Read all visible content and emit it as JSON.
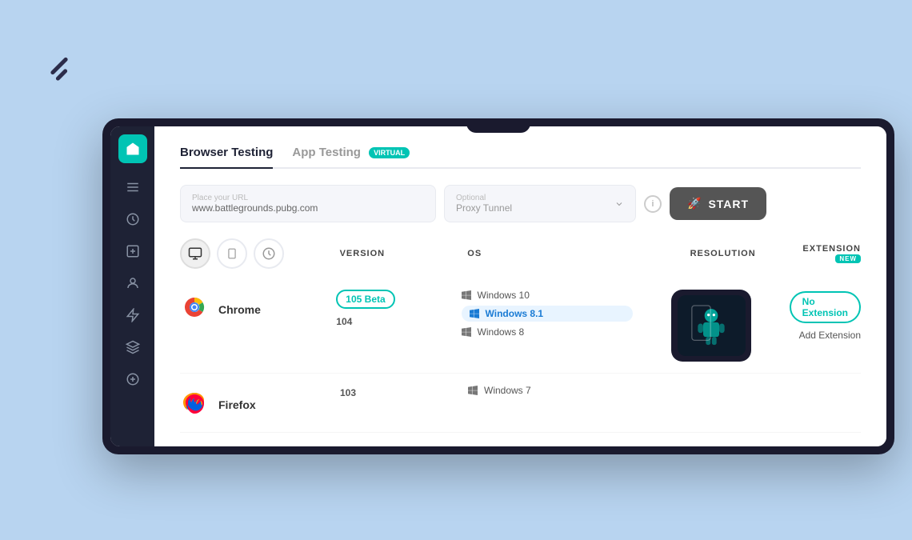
{
  "background": {
    "color": "#b8d4f0"
  },
  "deco_lines": {
    "visible": true
  },
  "device": {
    "frame_color": "#1a1a2e"
  },
  "sidebar": {
    "logo_tooltip": "Home",
    "icons": [
      {
        "name": "arrow-back-icon",
        "symbol": "↺",
        "active": false
      },
      {
        "name": "clock-icon",
        "symbol": "◷",
        "active": false
      },
      {
        "name": "plus-square-icon",
        "symbol": "⊞",
        "active": false
      },
      {
        "name": "user-icon",
        "symbol": "👤",
        "active": false
      },
      {
        "name": "bolt-icon",
        "symbol": "⚡",
        "active": false
      },
      {
        "name": "layers-icon",
        "symbol": "⊕",
        "active": false
      },
      {
        "name": "add-icon",
        "symbol": "+",
        "active": false
      }
    ]
  },
  "tabs": {
    "items": [
      {
        "id": "browser-testing",
        "label": "Browser Testing",
        "active": true,
        "badge": null
      },
      {
        "id": "app-testing",
        "label": "App Testing",
        "active": false,
        "badge": "VIRTUAL"
      }
    ]
  },
  "url_bar": {
    "url_label": "Place your URL",
    "url_value": "www.battlegrounds.pubg.com",
    "proxy_label": "Optional",
    "proxy_value": "Proxy Tunnel",
    "info_symbol": "i",
    "start_label": "START",
    "start_icon": "🚀"
  },
  "device_types": [
    {
      "id": "desktop",
      "symbol": "🖥",
      "active": true
    },
    {
      "id": "mobile",
      "symbol": "📱",
      "active": false
    },
    {
      "id": "history",
      "symbol": "◷",
      "active": false
    }
  ],
  "table": {
    "headers": {
      "version": "VERSION",
      "os": "OS",
      "resolution": "RESOLUTION",
      "extension": "EXTENSION",
      "extension_badge": "NEW"
    },
    "rows": [
      {
        "browser_name": "Chrome",
        "browser_type": "chrome",
        "versions": [
          {
            "label": "105 Beta",
            "style": "outline"
          },
          {
            "label": "104",
            "style": "plain"
          }
        ],
        "os_items": [
          {
            "label": "Windows 10",
            "selected": false
          },
          {
            "label": "Windows 8.1",
            "selected": true
          },
          {
            "label": "Windows 8",
            "selected": false
          }
        ],
        "has_resolution": true,
        "extension": {
          "no_extension_label": "No Extension",
          "add_label": "Add  Extension"
        }
      },
      {
        "browser_name": "Firefox",
        "browser_type": "firefox",
        "versions": [
          {
            "label": "103",
            "style": "plain"
          }
        ],
        "os_items": [
          {
            "label": "Windows 7",
            "selected": false
          }
        ],
        "has_resolution": false,
        "extension": null
      }
    ]
  }
}
